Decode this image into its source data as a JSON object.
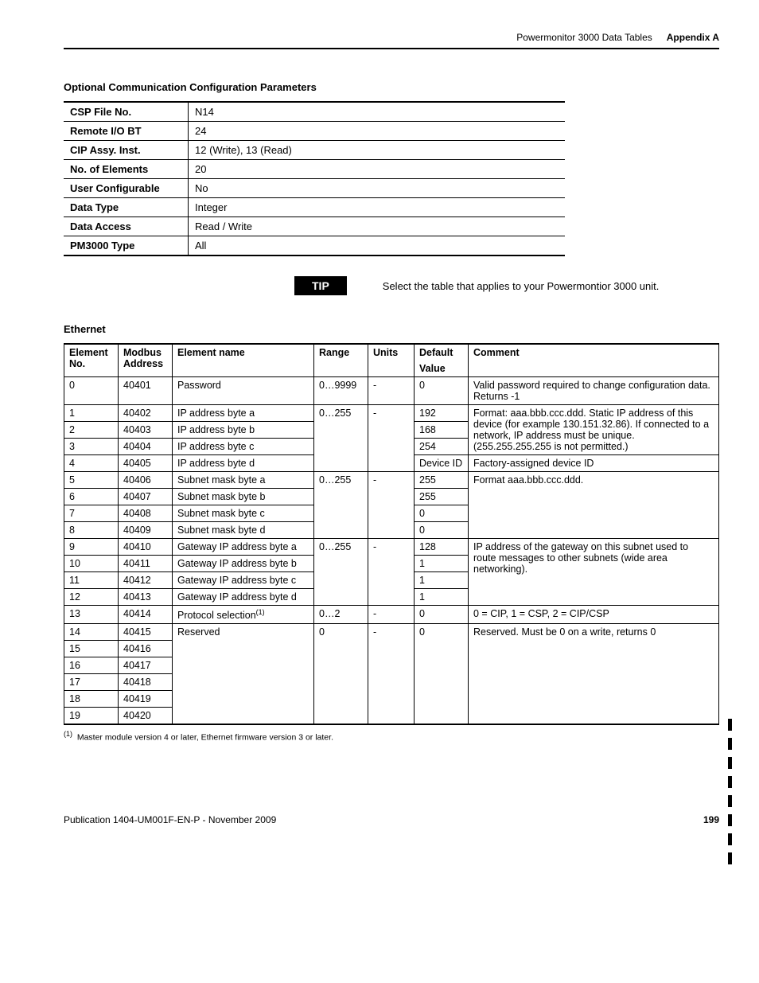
{
  "header": {
    "title": "Powermonitor 3000 Data Tables",
    "appendix": "Appendix A"
  },
  "section1_title": "Optional Communication Configuration  Parameters",
  "params": [
    {
      "label": "CSP File No.",
      "value": "N14"
    },
    {
      "label": "Remote I/O BT",
      "value": "24"
    },
    {
      "label": "CIP Assy. Inst.",
      "value": "12 (Write), 13 (Read)"
    },
    {
      "label": "No. of Elements",
      "value": "20"
    },
    {
      "label": "User Configurable",
      "value": "No"
    },
    {
      "label": "Data Type",
      "value": "Integer"
    },
    {
      "label": "Data Access",
      "value": "Read / Write"
    },
    {
      "label": "PM3000 Type",
      "value": "All"
    }
  ],
  "tip": {
    "label": "TIP",
    "text": "Select the table that applies to your Powermontior 3000 unit."
  },
  "section2_title": "Ethernet",
  "eth_headers": {
    "c0": "Element No.",
    "c1": "Modbus Address",
    "c2": "Element name",
    "c3": "Range",
    "c4": "Units",
    "c5a": "Default",
    "c5b": "Value",
    "c6": "Comment"
  },
  "eth": {
    "r0": {
      "no": "0",
      "mb": "40401",
      "name": "Password",
      "range": "0…9999",
      "units": "-",
      "def": "0",
      "comment": "Valid password required to change configuration data. Returns -1"
    },
    "r1": {
      "no": "1",
      "mb": "40402",
      "name": "IP address byte a",
      "range": "0…255",
      "units": "-",
      "def": "192"
    },
    "r2": {
      "no": "2",
      "mb": "40403",
      "name": "IP address byte b",
      "def": "168"
    },
    "r3": {
      "no": "3",
      "mb": "40404",
      "name": "IP address byte c",
      "def": "254"
    },
    "r4": {
      "no": "4",
      "mb": "40405",
      "name": "IP address byte d",
      "def": "Device ID",
      "comment": "Factory-assigned device ID"
    },
    "r5": {
      "no": "5",
      "mb": "40406",
      "name": "Subnet mask byte a",
      "range": "0…255",
      "units": "-",
      "def": "255",
      "comment": "Format aaa.bbb.ccc.ddd."
    },
    "r6": {
      "no": "6",
      "mb": "40407",
      "name": "Subnet mask byte b",
      "def": "255"
    },
    "r7": {
      "no": "7",
      "mb": "40408",
      "name": "Subnet mask byte c",
      "def": "0"
    },
    "r8": {
      "no": "8",
      "mb": "40409",
      "name": "Subnet mask byte d",
      "def": "0"
    },
    "r9": {
      "no": "9",
      "mb": "40410",
      "name": "Gateway IP address byte a",
      "range": "0…255",
      "units": "-",
      "def": "128",
      "comment": "IP address of the gateway on this subnet used to route messages to other subnets (wide area networking)."
    },
    "r10": {
      "no": "10",
      "mb": "40411",
      "name": "Gateway IP address byte b",
      "def": "1"
    },
    "r11": {
      "no": "11",
      "mb": "40412",
      "name": "Gateway IP address byte c",
      "def": "1"
    },
    "r12": {
      "no": "12",
      "mb": "40413",
      "name": "Gateway IP address byte d",
      "def": "1"
    },
    "r13": {
      "no": "13",
      "mb": "40414",
      "name_pre": "Protocol selection",
      "sup": "(1)",
      "range": "0…2",
      "units": "-",
      "def": "0",
      "comment": "0 = CIP, 1 = CSP, 2 = CIP/CSP"
    },
    "r14": {
      "no": "14",
      "mb": "40415",
      "name": "Reserved",
      "range": "0",
      "units": "-",
      "def": "0",
      "comment": "Reserved. Must be 0 on a write, returns 0"
    },
    "r15": {
      "no": "15",
      "mb": "40416"
    },
    "r16": {
      "no": "16",
      "mb": "40417"
    },
    "r17": {
      "no": "17",
      "mb": "40418"
    },
    "r18": {
      "no": "18",
      "mb": "40419"
    },
    "r19": {
      "no": "19",
      "mb": "40420"
    },
    "ip_comment": "Format: aaa.bbb.ccc.ddd. Static IP address of this device (for example 130.151.32.86). If connected to a network, IP address must be unique. (255.255.255.255 is not permitted.)"
  },
  "footnote": {
    "sup": "(1)",
    "text": "Master module version 4 or later, Ethernet firmware version 3 or later."
  },
  "footer": {
    "pub": "Publication 1404-UM001F-EN-P - November 2009",
    "page": "199"
  }
}
